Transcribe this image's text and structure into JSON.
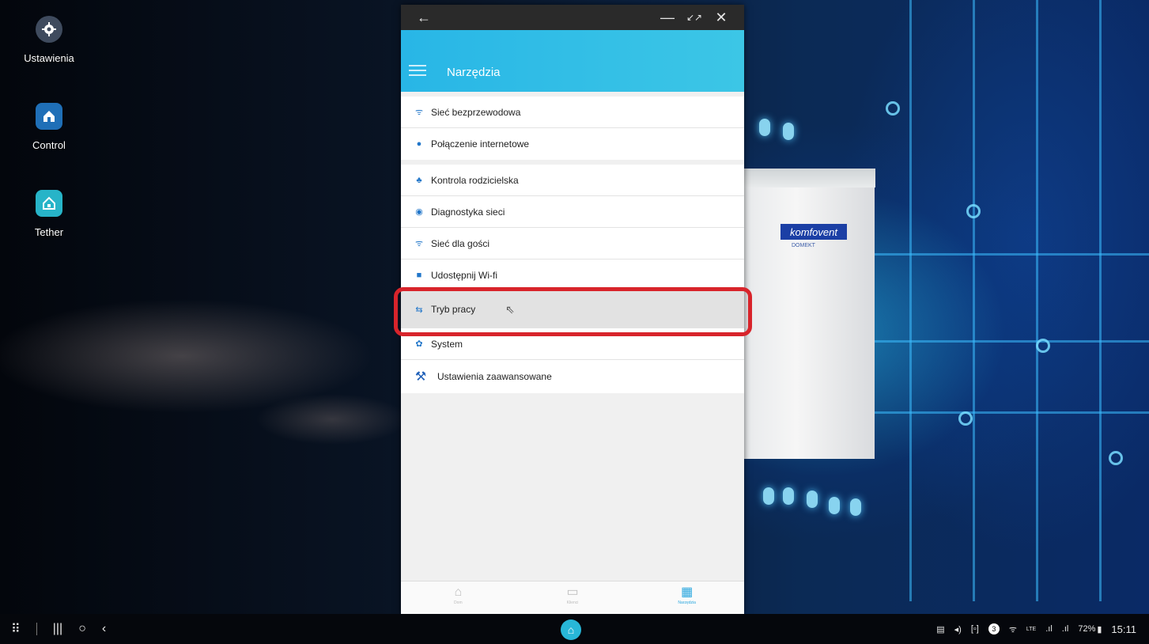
{
  "desktop": {
    "icons": [
      {
        "label": "Ustawienia",
        "icon": "gear-icon"
      },
      {
        "label": "Control",
        "icon": "house-icon"
      },
      {
        "label": "Tether",
        "icon": "house-router-icon"
      }
    ]
  },
  "product": {
    "brand": "komfovent",
    "model": "DOMEKT"
  },
  "window": {
    "back_icon": "back-arrow-icon",
    "minimize": "—",
    "restore": "↙↗",
    "close": "✕"
  },
  "app": {
    "title": "Narzędzia",
    "groups": [
      {
        "items": [
          {
            "label": "Sieć bezprzewodowa",
            "icon": "wifi-icon",
            "glyph": "ᯤ"
          },
          {
            "label": "Połączenie internetowe",
            "icon": "globe-icon",
            "glyph": "●"
          }
        ]
      },
      {
        "items": [
          {
            "label": "Kontrola rodzicielska",
            "icon": "parental-control-icon",
            "glyph": "♣"
          },
          {
            "label": "Diagnostyka sieci",
            "icon": "globe-search-icon",
            "glyph": "◉"
          },
          {
            "label": "Sieć dla gości",
            "icon": "guest-wifi-icon",
            "glyph": "ᯤ"
          },
          {
            "label": "Udostępnij Wi-fi",
            "icon": "share-wifi-icon",
            "glyph": "■"
          },
          {
            "label": "Tryb pracy",
            "icon": "mode-icon",
            "glyph": "⇆",
            "selected": true
          },
          {
            "label": "System",
            "icon": "gear-icon",
            "glyph": "✿"
          },
          {
            "label": "Ustawienia zaawansowane",
            "icon": "tools-icon",
            "glyph": "⚒"
          }
        ]
      }
    ],
    "bottom_nav": [
      {
        "label": "Dom",
        "icon": "home-icon",
        "glyph": "⌂"
      },
      {
        "label": "Klienci",
        "icon": "devices-icon",
        "glyph": "▭"
      },
      {
        "label": "Narzędzia",
        "icon": "tools-grid-icon",
        "glyph": "▦",
        "active": true
      }
    ]
  },
  "taskbar": {
    "apps_icon": "⠿",
    "recents_icon": "|||",
    "home_icon": "○",
    "back_icon": "‹",
    "center_app_icon": "⌂",
    "tray": {
      "keyboard": "▤",
      "volume": "◂)",
      "screenshot": "[▫]",
      "notifications_count": "3",
      "wifi": "ᯤ",
      "lte": "LTE",
      "signal1": ".ıl",
      "signal2": ".ıl",
      "battery": "72%",
      "battery_icon": "▮",
      "time": "15:11"
    }
  }
}
